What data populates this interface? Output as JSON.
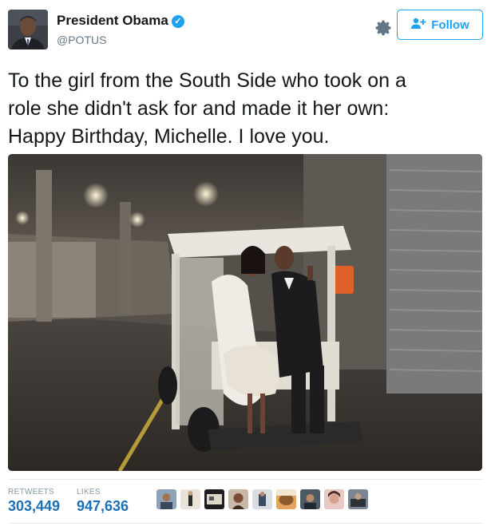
{
  "author": {
    "name": "President Obama",
    "handle": "@POTUS",
    "verified_icon": "verified-badge-icon",
    "accent": "#1da1f2"
  },
  "actions": {
    "follow_label": "Follow",
    "settings_icon": "gear-icon"
  },
  "tweet": {
    "lines": [
      "To the girl from the South Side who took on a",
      "role she didn't ask for and made it her own:",
      "Happy Birthday, Michelle. I love you."
    ]
  },
  "stats": {
    "retweets_label": "RETWEETS",
    "retweets_value": "303,449",
    "likes_label": "LIKES",
    "likes_value": "947,636",
    "value_color": "#1d6fb5"
  },
  "likers": [
    "liker-avatar-1",
    "liker-avatar-2",
    "liker-avatar-3",
    "liker-avatar-4",
    "liker-avatar-5",
    "liker-avatar-6",
    "liker-avatar-7",
    "liker-avatar-8",
    "liker-avatar-9"
  ]
}
